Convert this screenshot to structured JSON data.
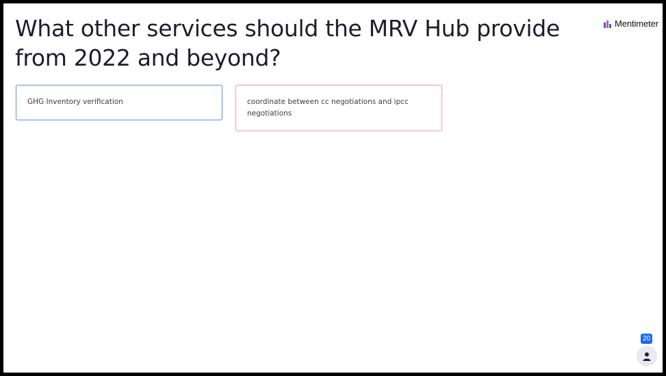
{
  "slide": {
    "question": "What other services should the MRV Hub provide from 2022 and beyond?"
  },
  "brand": {
    "name": "Mentimeter",
    "colors": [
      "#196cf0",
      "#ff4d5a"
    ]
  },
  "responses": [
    {
      "text": "GHG Inventory verification",
      "border_color": "#5b8fd8"
    },
    {
      "text": "coordinate between cc negotiations and ipcc negotiations",
      "border_color": "#ec93b8"
    }
  ],
  "participants": {
    "count": "20",
    "icon": "person-icon"
  }
}
